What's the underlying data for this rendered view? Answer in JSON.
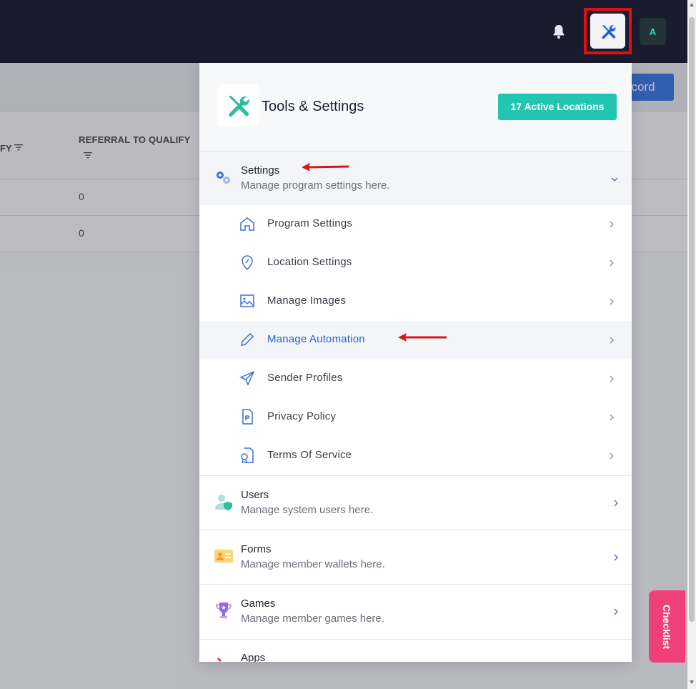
{
  "background": {
    "record_button_label": "ecord",
    "table": {
      "partial_column_header": "FY",
      "column_header": "REFERRAL TO QUALIFY",
      "rows": [
        {
          "referral_to_qualify": "0"
        },
        {
          "referral_to_qualify": "0"
        }
      ]
    }
  },
  "header": {
    "avatar_initial": "A",
    "icons": [
      "bell-icon",
      "tools-icon"
    ]
  },
  "panel": {
    "title": "Tools & Settings",
    "badge": "17 Active Locations",
    "sections": {
      "settings": {
        "title": "Settings",
        "description": "Manage program settings here.",
        "expanded": true,
        "items": [
          {
            "label": "Program Settings",
            "icon": "home-icon"
          },
          {
            "label": "Location Settings",
            "icon": "location-pin-icon"
          },
          {
            "label": "Manage Images",
            "icon": "image-icon"
          },
          {
            "label": "Manage Automation",
            "icon": "pencil-icon",
            "active": true
          },
          {
            "label": "Sender Profiles",
            "icon": "paper-plane-icon"
          },
          {
            "label": "Privacy Policy",
            "icon": "document-p-icon"
          },
          {
            "label": "Terms Of Service",
            "icon": "document-badge-icon"
          }
        ]
      },
      "users": {
        "title": "Users",
        "description": "Manage system users here."
      },
      "forms": {
        "title": "Forms",
        "description": "Manage member wallets here."
      },
      "games": {
        "title": "Games",
        "description": "Manage member games here."
      },
      "apps": {
        "title": "Apps"
      }
    }
  },
  "checklist_label": "Checklist",
  "colors": {
    "topbar": "#1b1b2e",
    "accent_teal": "#22c6b0",
    "active_link": "#1d63d8",
    "highlight_red": "#e01010",
    "checklist": "#f0407a"
  }
}
